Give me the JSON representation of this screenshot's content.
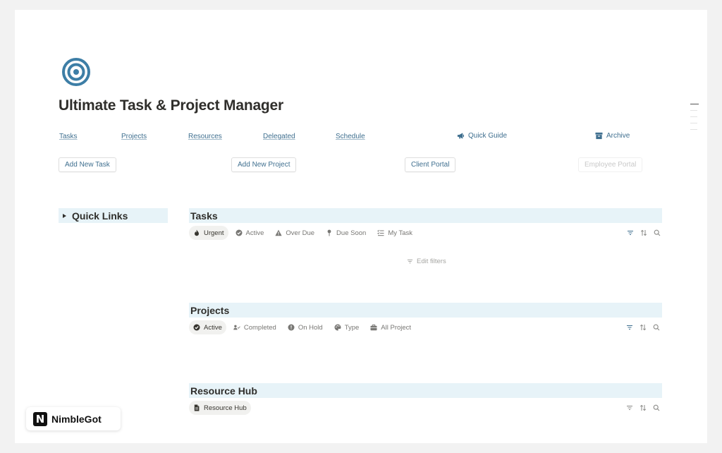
{
  "title": "Ultimate Task & Project Manager",
  "colors": {
    "accent": "#3f6f8f",
    "icon": "#3d7ea6",
    "section_bg": "#e7f3f8",
    "page_bg": "#ffffff"
  },
  "nav": {
    "links": [
      {
        "label": "Tasks",
        "icon": null
      },
      {
        "label": "Projects",
        "icon": null
      },
      {
        "label": "Resources",
        "icon": null
      },
      {
        "label": "Delegated",
        "icon": null
      },
      {
        "label": "Schedule",
        "icon": null
      }
    ],
    "quick_guide": {
      "label": "Quick Guide",
      "icon": "megaphone-icon"
    },
    "archive": {
      "label": "Archive",
      "icon": "archive-box-icon"
    }
  },
  "buttons": {
    "add_task": "Add New Task",
    "add_project": "Add New Project",
    "client_portal": "Client Portal",
    "employee_portal": "Employee Portal"
  },
  "quick_links": {
    "label": "Quick Links"
  },
  "tasks": {
    "title": "Tasks",
    "views": [
      {
        "label": "Urgent",
        "icon": "fire-icon",
        "active": true
      },
      {
        "label": "Active",
        "icon": "check-circle-icon",
        "active": false
      },
      {
        "label": "Over Due",
        "icon": "warning-icon",
        "active": false
      },
      {
        "label": "Due Soon",
        "icon": "pin-icon",
        "active": false
      },
      {
        "label": "My Task",
        "icon": "checklist-icon",
        "active": false
      }
    ],
    "edit_filters": "Edit filters"
  },
  "projects": {
    "title": "Projects",
    "views": [
      {
        "label": "Active",
        "icon": "check-circle-icon",
        "active": true
      },
      {
        "label": "Completed",
        "icon": "person-check-icon",
        "active": false
      },
      {
        "label": "On Hold",
        "icon": "alert-circle-icon",
        "active": false
      },
      {
        "label": "Type",
        "icon": "palette-icon",
        "active": false
      },
      {
        "label": "All Project",
        "icon": "briefcase-icon",
        "active": false
      }
    ]
  },
  "resources": {
    "title": "Resource Hub",
    "views": [
      {
        "label": "Resource Hub",
        "icon": "document-icon",
        "active": true
      }
    ]
  },
  "brand": {
    "name": "NimbleGot",
    "mark": "N"
  }
}
